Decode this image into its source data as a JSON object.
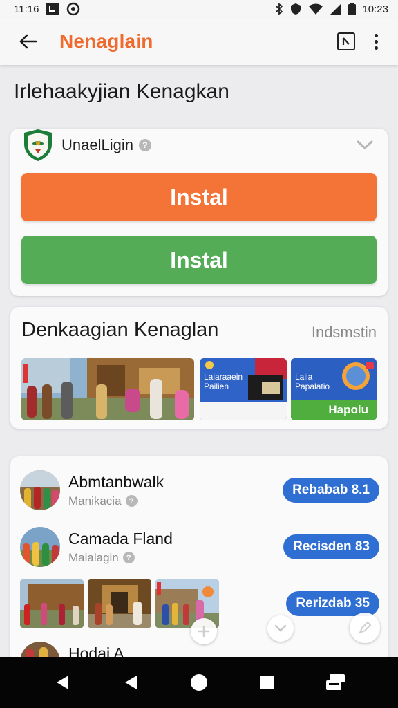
{
  "status": {
    "left_time": "11:16",
    "right_time": "10:23"
  },
  "app_bar": {
    "title": "Nenaglain"
  },
  "page_heading": "Irlehaakyjian Kenagkan",
  "app_card": {
    "app_name": "UnaelLigin",
    "primary_button": "Instal",
    "secondary_button": "Instal"
  },
  "media_section": {
    "title": "Denkaagian Kenaglan",
    "link": "Indsmstin",
    "thumbs": [
      {
        "kind": "photo"
      },
      {
        "kind": "promo",
        "text_line1": "Laiaraaein",
        "text_line2": "Pailien"
      },
      {
        "kind": "promo",
        "text_line1": "Laiia",
        "text_line2": "Papalatio",
        "footer": "Hapoiu"
      }
    ]
  },
  "list": {
    "items": [
      {
        "title": "Abmtanbwalk",
        "subtitle": "Manikacia",
        "pill": "Rebabab 8.1"
      },
      {
        "title": "Camada Fland",
        "subtitle": "Maialagin",
        "pill": "Recisden 83"
      }
    ],
    "photo_row_pill": "Rerizdab 35",
    "partial_item": {
      "title": "Hodai A"
    }
  },
  "colors": {
    "accent": "#ef6a2c",
    "install_orange": "#f47336",
    "install_green": "#54ad56",
    "pill_blue": "#2f6fd3"
  }
}
